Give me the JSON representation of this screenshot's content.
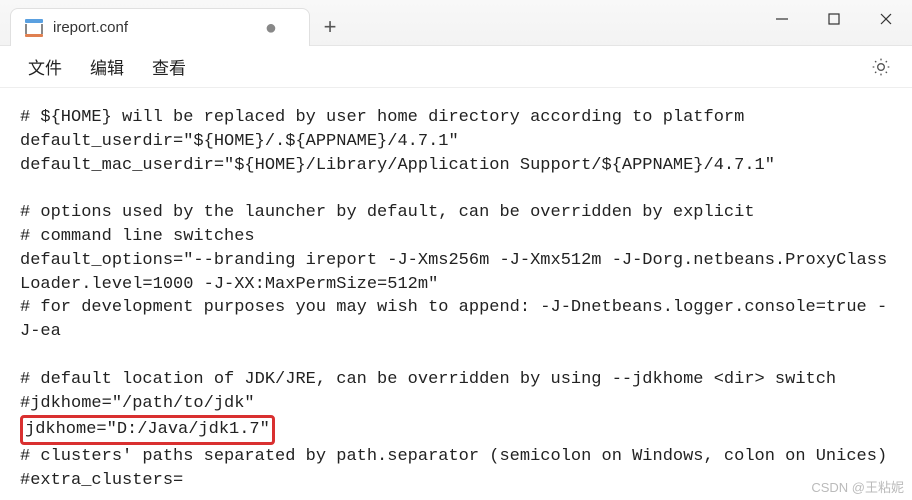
{
  "tab": {
    "title": "ireport.conf",
    "dirty": "●"
  },
  "newtab": "+",
  "menu": {
    "file": "文件",
    "edit": "编辑",
    "view": "查看"
  },
  "editor": {
    "l1": "# ${HOME} will be replaced by user home directory according to platform",
    "l2": "default_userdir=\"${HOME}/.${APPNAME}/4.7.1\"",
    "l3": "default_mac_userdir=\"${HOME}/Library/Application Support/${APPNAME}/4.7.1\"",
    "l4": "",
    "l5": "# options used by the launcher by default, can be overridden by explicit",
    "l6": "# command line switches",
    "l7": "default_options=\"--branding ireport -J-Xms256m -J-Xmx512m -J-Dorg.netbeans.ProxyClassLoader.level=1000 -J-XX:MaxPermSize=512m\"",
    "l8": "# for development purposes you may wish to append: -J-Dnetbeans.logger.console=true -J-ea",
    "l9": "",
    "l10": "# default location of JDK/JRE, can be overridden by using --jdkhome <dir> switch",
    "l11": "#jdkhome=\"/path/to/jdk\"",
    "l12": "jdkhome=\"D:/Java/jdk1.7\"",
    "l13": "# clusters' paths separated by path.separator (semicolon on Windows, colon on Unices)",
    "l14": "#extra_clusters="
  },
  "watermark": "CSDN @王粘妮"
}
